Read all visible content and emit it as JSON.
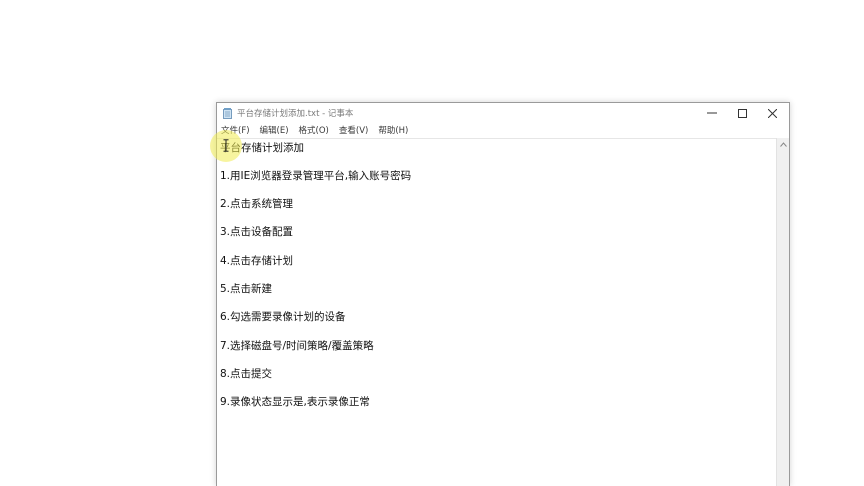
{
  "window": {
    "title": "平台存储计划添加.txt - 记事本",
    "menu": [
      "文件(F)",
      "编辑(E)",
      "格式(O)",
      "查看(V)",
      "帮助(H)"
    ]
  },
  "document": {
    "lines": [
      "平台存储计划添加",
      "1.用IE浏览器登录管理平台,输入账号密码",
      "2.点击系统管理",
      "3.点击设备配置",
      "4.点击存储计划",
      "5.点击新建",
      "6.勾选需要录像计划的设备",
      "7.选择磁盘号/时间策略/覆盖策略",
      "8.点击提交",
      "9.录像状态显示是,表示录像正常"
    ]
  },
  "colors": {
    "highlight": "#f0eb50",
    "text": "#111111"
  },
  "icons": [
    "notepad-icon",
    "minimize-icon",
    "maximize-icon",
    "close-icon",
    "scroll-up-icon",
    "text-cursor-icon"
  ]
}
